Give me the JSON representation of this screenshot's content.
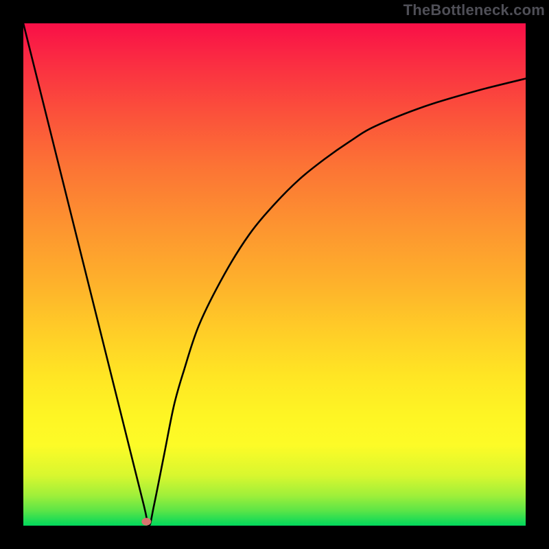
{
  "chart_data": {
    "type": "line",
    "title": "",
    "xlabel": "",
    "ylabel": "",
    "xlim": [
      0,
      100
    ],
    "ylim": [
      0,
      100
    ],
    "grid": false,
    "legend": false,
    "curve_note": "Black V-shaped curve; x/y in percent of plot area (y=0 at bottom). Left branch nearly linear from top-left, right branch asymptotes toward upper right. Single salmon marker near the minimum.",
    "series": [
      {
        "name": "curve",
        "x": [
          0,
          4,
          8,
          12,
          16,
          20,
          24,
          25,
          26,
          28,
          30,
          32,
          35,
          40,
          45,
          50,
          55,
          60,
          65,
          70,
          80,
          90,
          100
        ],
        "y": [
          100,
          84,
          68,
          52,
          36,
          20,
          4,
          0,
          4,
          14,
          24,
          31,
          40,
          50,
          58,
          64,
          69,
          73,
          76.5,
          79.5,
          83.5,
          86.5,
          89
        ]
      }
    ],
    "marker": {
      "x": 24.5,
      "y": 0.8
    },
    "gradient_colors": {
      "top": "#f90f47",
      "mid": "#ffe524",
      "bottom": "#02d85c"
    }
  },
  "attribution": {
    "label": "TheBottleneck.com"
  }
}
